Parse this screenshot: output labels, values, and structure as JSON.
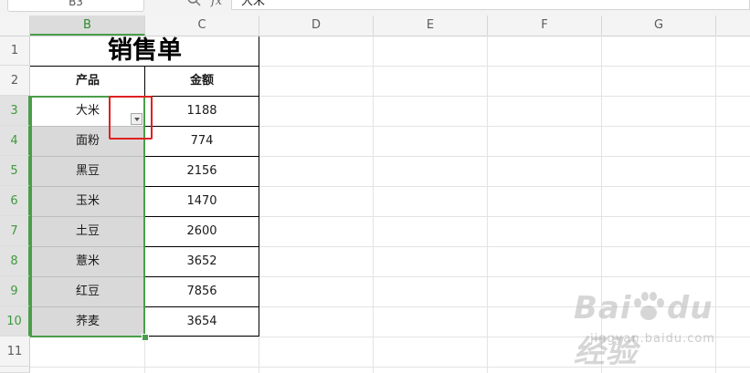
{
  "formula_bar": {
    "name_box": "B3",
    "function_label": "fx",
    "content": "大米"
  },
  "columns": [
    "B",
    "C",
    "D",
    "E",
    "F",
    "G"
  ],
  "rows": [
    "1",
    "2",
    "3",
    "4",
    "5",
    "6",
    "7",
    "8",
    "9",
    "10",
    "11"
  ],
  "sheet": {
    "title": "销售单",
    "headers": {
      "product": "产品",
      "amount": "金额"
    },
    "records": [
      {
        "product": "大米",
        "amount": "1188"
      },
      {
        "product": "面粉",
        "amount": "774"
      },
      {
        "product": "黑豆",
        "amount": "2156"
      },
      {
        "product": "玉米",
        "amount": "1470"
      },
      {
        "product": "土豆",
        "amount": "2600"
      },
      {
        "product": "薏米",
        "amount": "3652"
      },
      {
        "product": "红豆",
        "amount": "7856"
      },
      {
        "product": "荞麦",
        "amount": "3654"
      }
    ]
  },
  "icons": {
    "dropdown": "chevron-down-icon",
    "search": "search-icon"
  },
  "watermark": {
    "logo": "Bai du 经验",
    "url": "jingyan.baidu.com"
  },
  "colors": {
    "selection": "#4a9e4a",
    "highlight": "#e02020",
    "selected_fill": "#d9d9d9"
  }
}
